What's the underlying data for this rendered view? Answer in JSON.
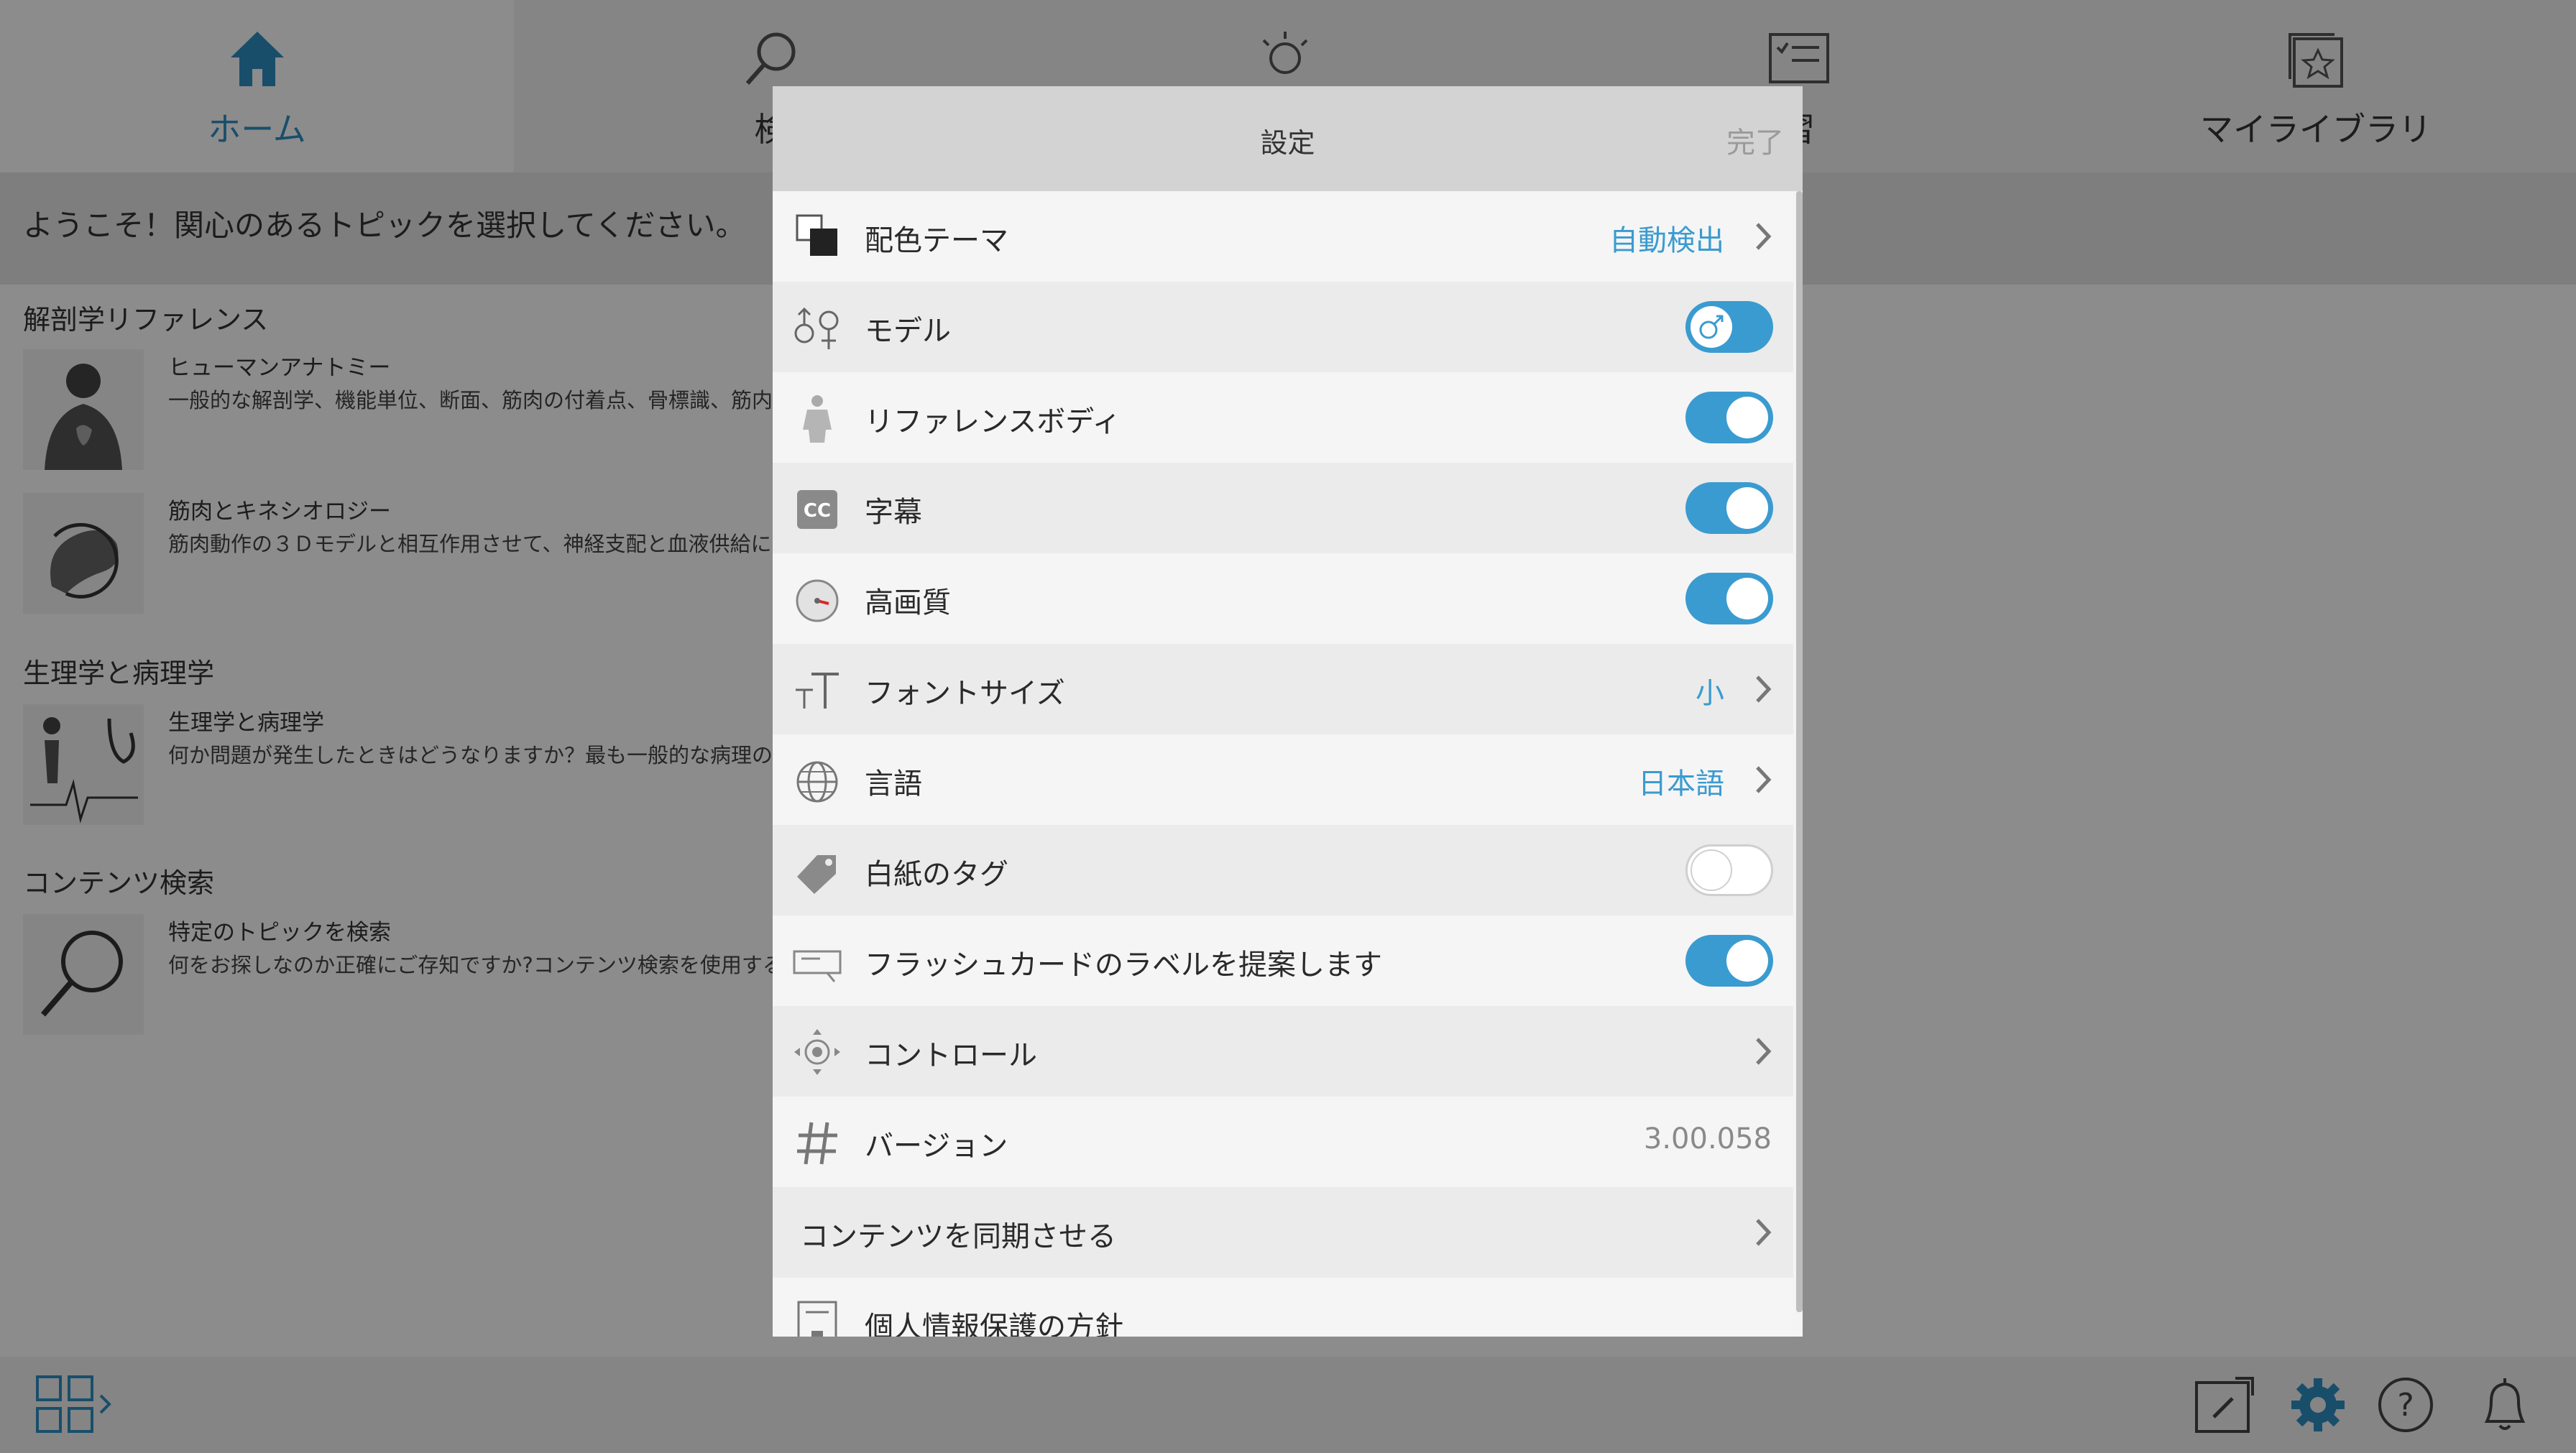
{
  "topnav": {
    "items": [
      {
        "label": "ホーム",
        "icon": "home-icon",
        "active": true
      },
      {
        "label": "検",
        "icon": "search-icon"
      },
      {
        "label": "",
        "icon": "lightbulb-icon"
      },
      {
        "label": "習",
        "icon": "quiz-icon"
      },
      {
        "label": "マイライブラリ",
        "icon": "library-icon"
      }
    ]
  },
  "welcome": "ようこそ！関心のあるトピックを選択してください。",
  "sections": [
    {
      "title": "解剖学リファレンス",
      "items": [
        {
          "title": "ヒューマンアナトミー",
          "desc": "一般的な解剖学、機能単位、断面、筋肉の付着点、骨標識、筋内"
        },
        {
          "title": "筋肉とキネシオロジー",
          "desc": "筋肉動作の３Ｄモデルと相互作用させて、神経支配と血液供給に"
        }
      ]
    },
    {
      "title": "生理学と病理学",
      "items": [
        {
          "title": "生理学と病理学",
          "desc": "何か問題が発生したときはどうなりますか？最も一般的な病理の"
        }
      ]
    },
    {
      "title": "コンテンツ検索",
      "items": [
        {
          "title": "特定のトピックを検索",
          "desc": "何をお探しなのか正確にご存知ですか?コンテンツ検索を使用する"
        }
      ]
    }
  ],
  "modal": {
    "title": "設定",
    "done": "完了",
    "rows": [
      {
        "label": "配色テーマ",
        "icon": "color-theme-icon",
        "value": "自動検出",
        "type": "link"
      },
      {
        "label": "モデル",
        "icon": "gender-icon",
        "type": "toggle-gender",
        "state": "male"
      },
      {
        "label": "リファレンスボディ",
        "icon": "body-icon",
        "type": "toggle",
        "on": true
      },
      {
        "label": "字幕",
        "icon": "cc-icon",
        "icon_text": "CC",
        "type": "toggle",
        "on": true
      },
      {
        "label": "高画質",
        "icon": "quality-gauge-icon",
        "type": "toggle",
        "on": true
      },
      {
        "label": "フォントサイズ",
        "icon": "font-size-icon",
        "value": "小",
        "type": "link"
      },
      {
        "label": "言語",
        "icon": "globe-icon",
        "value": "日本語",
        "type": "link"
      },
      {
        "label": "白紙のタグ",
        "icon": "tag-icon",
        "type": "toggle",
        "on": false
      },
      {
        "label": "フラッシュカードのラベルを提案します",
        "icon": "flashcard-label-icon",
        "type": "toggle",
        "on": true
      },
      {
        "label": "コントロール",
        "icon": "controls-icon",
        "type": "link"
      },
      {
        "label": "バージョン",
        "icon": "hash-icon",
        "value": "3.00.058",
        "type": "info"
      },
      {
        "label": "コンテンツを同期させる",
        "type": "link"
      },
      {
        "label": "個人情報保護の方針",
        "icon": "privacy-icon",
        "type": "link"
      }
    ]
  },
  "colors": {
    "accent": "#3a9bd0",
    "header": "#d3d3d3",
    "row_light": "#f5f5f5",
    "row_dark": "#ebebeb"
  }
}
